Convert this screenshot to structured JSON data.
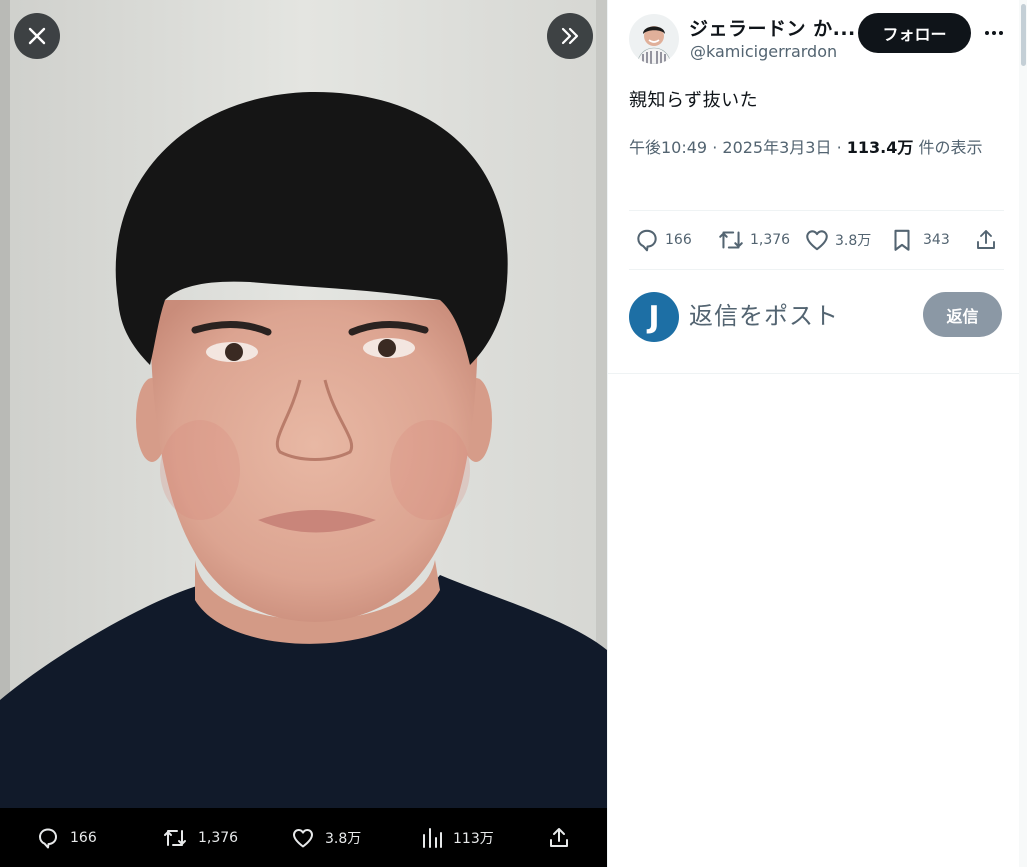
{
  "media": {
    "icons": {
      "close": "close-x-icon",
      "expand": "double-chevron-right-icon"
    },
    "stats": {
      "replies": "166",
      "reposts": "1,376",
      "likes": "3.8万",
      "views": "113万"
    }
  },
  "tweet": {
    "author": {
      "display_name": "ジェラードン か...",
      "handle": "@kamicigerrardon"
    },
    "follow_label": "フォロー",
    "text": "親知らず抜いた",
    "meta": {
      "time": "午後10:49",
      "separator1": " · ",
      "date": "2025年3月3日",
      "separator2": " · ",
      "views_count": "113.4万",
      "views_label": " 件の表示"
    },
    "actions": {
      "replies": "166",
      "reposts": "1,376",
      "likes": "3.8万",
      "bookmarks": "343"
    },
    "reply_box": {
      "avatar_letter": "J",
      "placeholder": "返信をポスト",
      "button_label": "返信"
    }
  },
  "colors": {
    "text_primary": "#0f1419",
    "text_secondary": "#536471",
    "follow_bg": "#0f1419",
    "reply_button_bg": "#8b98a5",
    "reply_avatar_bg": "#1d6fa5"
  }
}
